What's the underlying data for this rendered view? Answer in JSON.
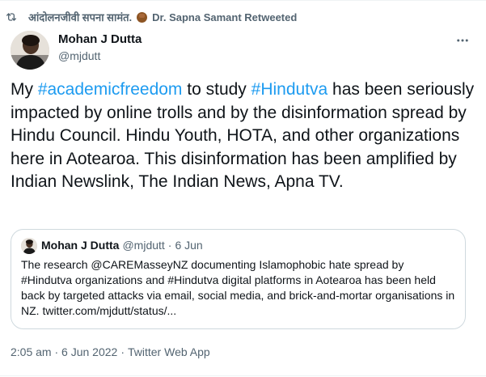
{
  "retweet_bar": {
    "retweeter_name": "आंदोलनजीवी सपना सामंत.",
    "retweeter_display": "Dr. Sapna Samant Retweeted"
  },
  "tweet": {
    "author_name": "Mohan J Dutta",
    "author_handle": "@mjdutt",
    "text_segments": {
      "part1": "My ",
      "hashtag1": "#academicfreedom",
      "part2": " to study ",
      "hashtag2": "#Hindutva",
      "part3": " has been seriously impacted by online trolls and by the disinformation spread by Hindu Council. Hindu Youth, HOTA, and other organizations here in Aotearoa. This disinformation has been amplified by Indian Newslink, The Indian News, Apna TV."
    },
    "timestamp": "2:05 am · 6 Jun 2022",
    "source": "Twitter Web App"
  },
  "quote": {
    "author_name": "Mohan J Dutta",
    "author_handle": "@mjdutt",
    "separator": "·",
    "date": "6 Jun",
    "text": "The research @CAREMasseyNZ documenting Islamophobic hate spread by #Hindutva organizations and #Hindutva digital platforms in Aotearoa has been held back by targeted attacks via email, social media, and brick-and-mortar organisations in NZ. twitter.com/mjdutt/status/..."
  },
  "meta_separator": "·",
  "colors": {
    "link": "#1d9bf0",
    "secondary_text": "#536471",
    "primary_text": "#0f1419",
    "border": "#cfd9de"
  },
  "icons": {
    "retweet": "retweet-icon",
    "more": "more-horizontal-icon"
  }
}
